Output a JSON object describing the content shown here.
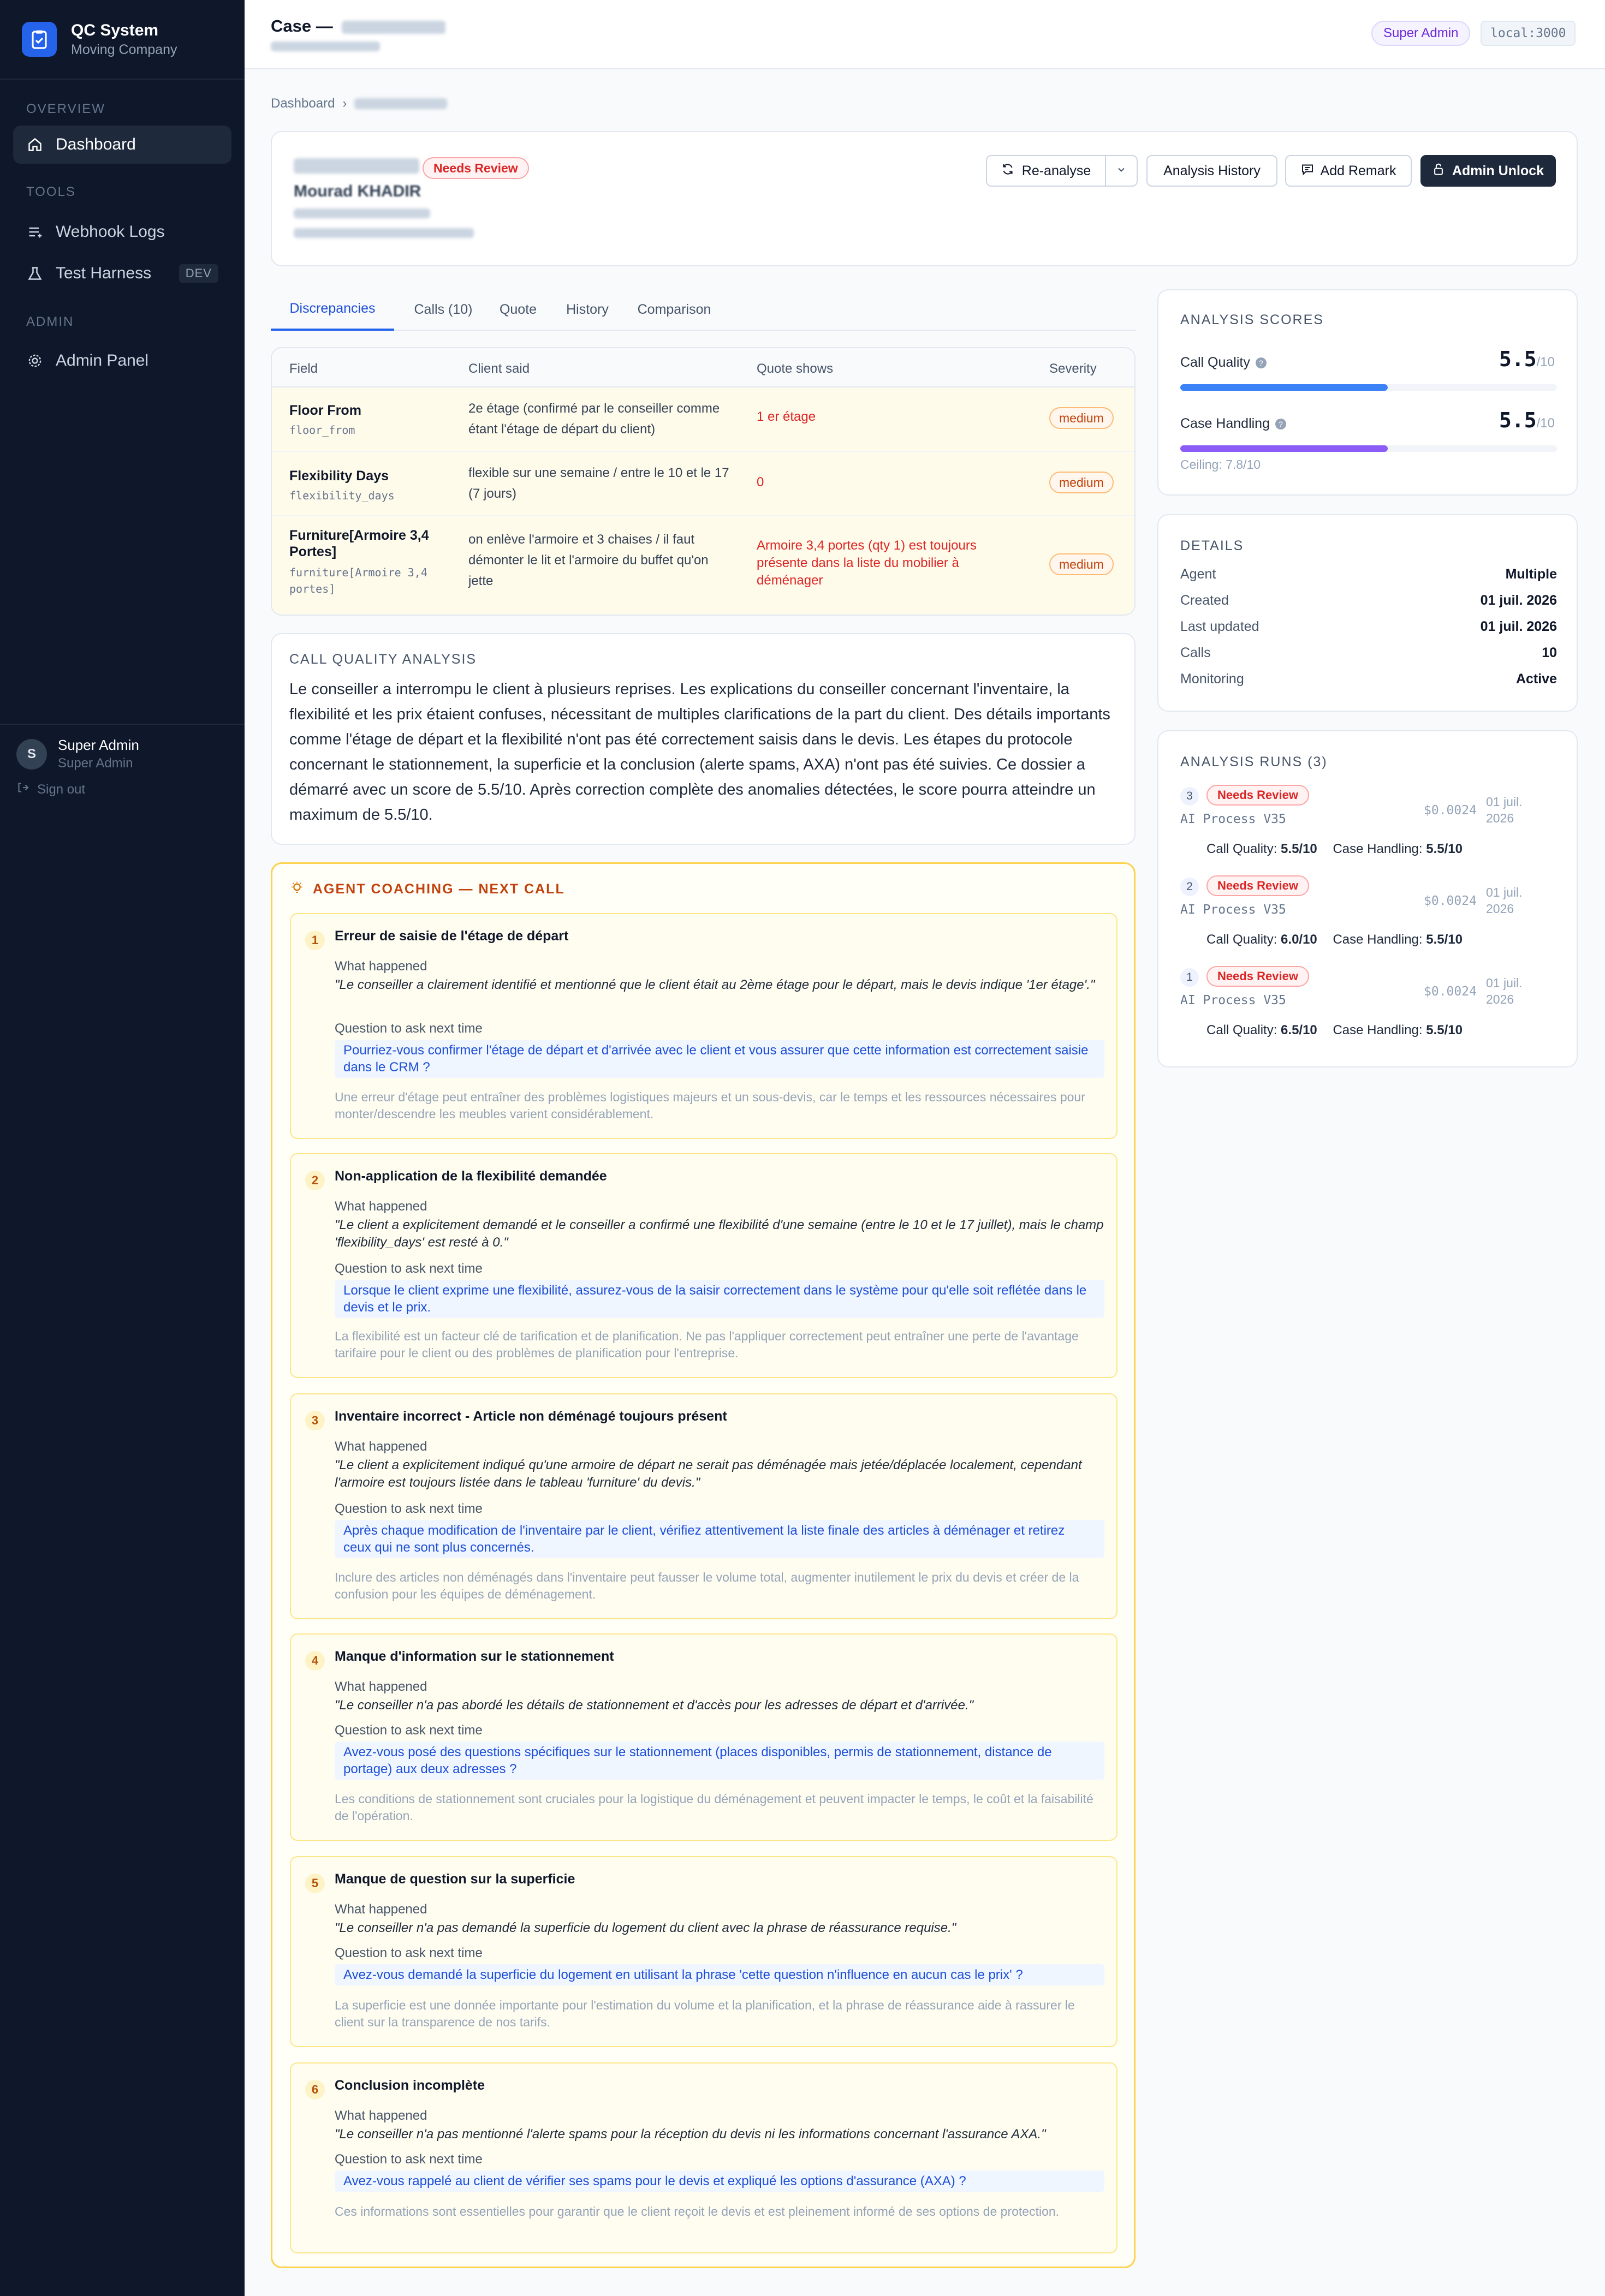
{
  "sidebar": {
    "app_name": "QC System",
    "company": "Moving Company",
    "sections": {
      "overview": "OVERVIEW",
      "tools": "TOOLS",
      "admin": "ADMIN"
    },
    "items": [
      {
        "label": "Dashboard",
        "icon": "home-icon",
        "active": true
      },
      {
        "label": "Webhook Logs",
        "icon": "list-icon"
      },
      {
        "label": "Test Harness",
        "icon": "flask-icon",
        "badge": "DEV"
      },
      {
        "label": "Admin Panel",
        "icon": "gear-icon"
      }
    ],
    "user": {
      "initial": "S",
      "name": "Super Admin",
      "role": "Super Admin",
      "signout": "Sign out"
    }
  },
  "topbar": {
    "case_prefix": "Case —",
    "role_badge": "Super Admin",
    "host": "local:3000"
  },
  "breadcrumb": {
    "root": "Dashboard",
    "sep": "›"
  },
  "header": {
    "status": "Needs Review",
    "client_name": "Mourad KHADIR",
    "buttons": {
      "reanalyse": "Re-analyse",
      "history": "Analysis History",
      "remark": "Add Remark",
      "unlock": "Admin Unlock"
    }
  },
  "tabs": [
    "Discrepancies",
    "Calls (10)",
    "Quote",
    "History",
    "Comparison"
  ],
  "discrepancies": {
    "headers": [
      "Field",
      "Client said",
      "Quote shows",
      "Severity"
    ],
    "rows": [
      {
        "field": "Floor From",
        "key": "floor_from",
        "client": "2e étage (confirmé par le conseiller comme étant l'étage de départ du client)",
        "quote": "1 er étage",
        "severity": "medium"
      },
      {
        "field": "Flexibility Days",
        "key": "flexibility_days",
        "client": "flexible sur une semaine / entre le 10 et le 17 (7 jours)",
        "quote": "0",
        "severity": "medium"
      },
      {
        "field": "Furniture[Armoire 3,4 Portes]",
        "key": "furniture[Armoire 3,4 portes]",
        "client": "on enlève l'armoire et 3 chaises / il faut démonter le lit et l'armoire du buffet qu'on jette",
        "quote": "Armoire 3,4 portes (qty 1) est toujours présente dans la liste du mobilier à déménager",
        "severity": "medium"
      }
    ]
  },
  "call_quality": {
    "label": "CALL QUALITY ANALYSIS",
    "text": "Le conseiller a interrompu le client à plusieurs reprises. Les explications du conseiller concernant l'inventaire, la flexibilité et les prix étaient confuses, nécessitant de multiples clarifications de la part du client. Des détails importants comme l'étage de départ et la flexibilité n'ont pas été correctement saisis dans le devis. Les étapes du protocole concernant le stationnement, la superficie et la conclusion (alerte spams, AXA) n'ont pas été suivies. Ce dossier a démarré avec un score de 5.5/10. Après correction complète des anomalies détectées, le score pourra atteindre un maximum de 5.5/10."
  },
  "coaching": {
    "label": "AGENT COACHING — NEXT CALL",
    "what_label": "What happened",
    "ask_label": "Question to ask next time",
    "items": [
      {
        "n": "1",
        "title": "Erreur de saisie de l'étage de départ",
        "what": "\"Le conseiller a clairement identifié et mentionné que le client était au 2ème étage pour le départ, mais le devis indique '1er étage'.\"",
        "ask": "Pourriez-vous confirmer l'étage de départ et d'arrivée avec le client et vous assurer que cette information est correctement saisie dans le CRM ?",
        "note": "Une erreur d'étage peut entraîner des problèmes logistiques majeurs et un sous-devis, car le temps et les ressources nécessaires pour monter/descendre les meubles varient considérablement."
      },
      {
        "n": "2",
        "title": "Non-application de la flexibilité demandée",
        "what": "\"Le client a explicitement demandé et le conseiller a confirmé une flexibilité d'une semaine (entre le 10 et le 17 juillet), mais le champ 'flexibility_days' est resté à 0.\"",
        "ask": "Lorsque le client exprime une flexibilité, assurez-vous de la saisir correctement dans le système pour qu'elle soit reflétée dans le devis et le prix.",
        "note": "La flexibilité est un facteur clé de tarification et de planification. Ne pas l'appliquer correctement peut entraîner une perte de l'avantage tarifaire pour le client ou des problèmes de planification pour l'entreprise."
      },
      {
        "n": "3",
        "title": "Inventaire incorrect - Article non déménagé toujours présent",
        "what": "\"Le client a explicitement indiqué qu'une armoire de départ ne serait pas déménagée mais jetée/déplacée localement, cependant l'armoire est toujours listée dans le tableau 'furniture' du devis.\"",
        "ask": "Après chaque modification de l'inventaire par le client, vérifiez attentivement la liste finale des articles à déménager et retirez ceux qui ne sont plus concernés.",
        "note": "Inclure des articles non déménagés dans l'inventaire peut fausser le volume total, augmenter inutilement le prix du devis et créer de la confusion pour les équipes de déménagement."
      },
      {
        "n": "4",
        "title": "Manque d'information sur le stationnement",
        "what": "\"Le conseiller n'a pas abordé les détails de stationnement et d'accès pour les adresses de départ et d'arrivée.\"",
        "ask": "Avez-vous posé des questions spécifiques sur le stationnement (places disponibles, permis de stationnement, distance de portage) aux deux adresses ?",
        "note": "Les conditions de stationnement sont cruciales pour la logistique du déménagement et peuvent impacter le temps, le coût et la faisabilité de l'opération."
      },
      {
        "n": "5",
        "title": "Manque de question sur la superficie",
        "what": "\"Le conseiller n'a pas demandé la superficie du logement du client avec la phrase de réassurance requise.\"",
        "ask": "Avez-vous demandé la superficie du logement en utilisant la phrase 'cette question n'influence en aucun cas le prix' ?",
        "note": "La superficie est une donnée importante pour l'estimation du volume et la planification, et la phrase de réassurance aide à rassurer le client sur la transparence de nos tarifs."
      },
      {
        "n": "6",
        "title": "Conclusion incomplète",
        "what": "\"Le conseiller n'a pas mentionné l'alerte spams pour la réception du devis ni les informations concernant l'assurance AXA.\"",
        "ask": "Avez-vous rappelé au client de vérifier ses spams pour le devis et expliqué les options d'assurance (AXA) ?",
        "note": "Ces informations sont essentielles pour garantir que le client reçoit le devis et est pleinement informé de ses options de protection."
      }
    ]
  },
  "scores": {
    "label": "ANALYSIS SCORES",
    "call_quality": {
      "label": "Call Quality",
      "value": "5.5",
      "max": "/10",
      "fraction": 0.55,
      "color": "#3b82f6"
    },
    "case_handling": {
      "label": "Case Handling",
      "value": "5.5",
      "max": "/10",
      "fraction": 0.55,
      "color": "#8b5cf6"
    },
    "ceiling": "Ceiling: 7.8/10"
  },
  "details": {
    "label": "DETAILS",
    "rows": [
      {
        "k": "Agent",
        "v": "Multiple"
      },
      {
        "k": "Created",
        "v": "01 juil. 2026"
      },
      {
        "k": "Last updated",
        "v": "01 juil. 2026"
      },
      {
        "k": "Calls",
        "v": "10"
      },
      {
        "k": "Monitoring",
        "v": "Active"
      }
    ]
  },
  "runs": {
    "label": "ANALYSIS RUNS (3)",
    "cq_label": "Call Quality:",
    "ch_label": "Case Handling:",
    "items": [
      {
        "n": "3",
        "status": "Needs Review",
        "process": "AI Process V35",
        "cost": "$0.0024",
        "date1": "01 juil.",
        "date2": "2026",
        "cq": "5.5/10",
        "ch": "5.5/10"
      },
      {
        "n": "2",
        "status": "Needs Review",
        "process": "AI Process V35",
        "cost": "$0.0024",
        "date1": "01 juil.",
        "date2": "2026",
        "cq": "6.0/10",
        "ch": "5.5/10"
      },
      {
        "n": "1",
        "status": "Needs Review",
        "process": "AI Process V35",
        "cost": "$0.0024",
        "date1": "01 juil.",
        "date2": "2026",
        "cq": "6.5/10",
        "ch": "5.5/10"
      }
    ]
  }
}
